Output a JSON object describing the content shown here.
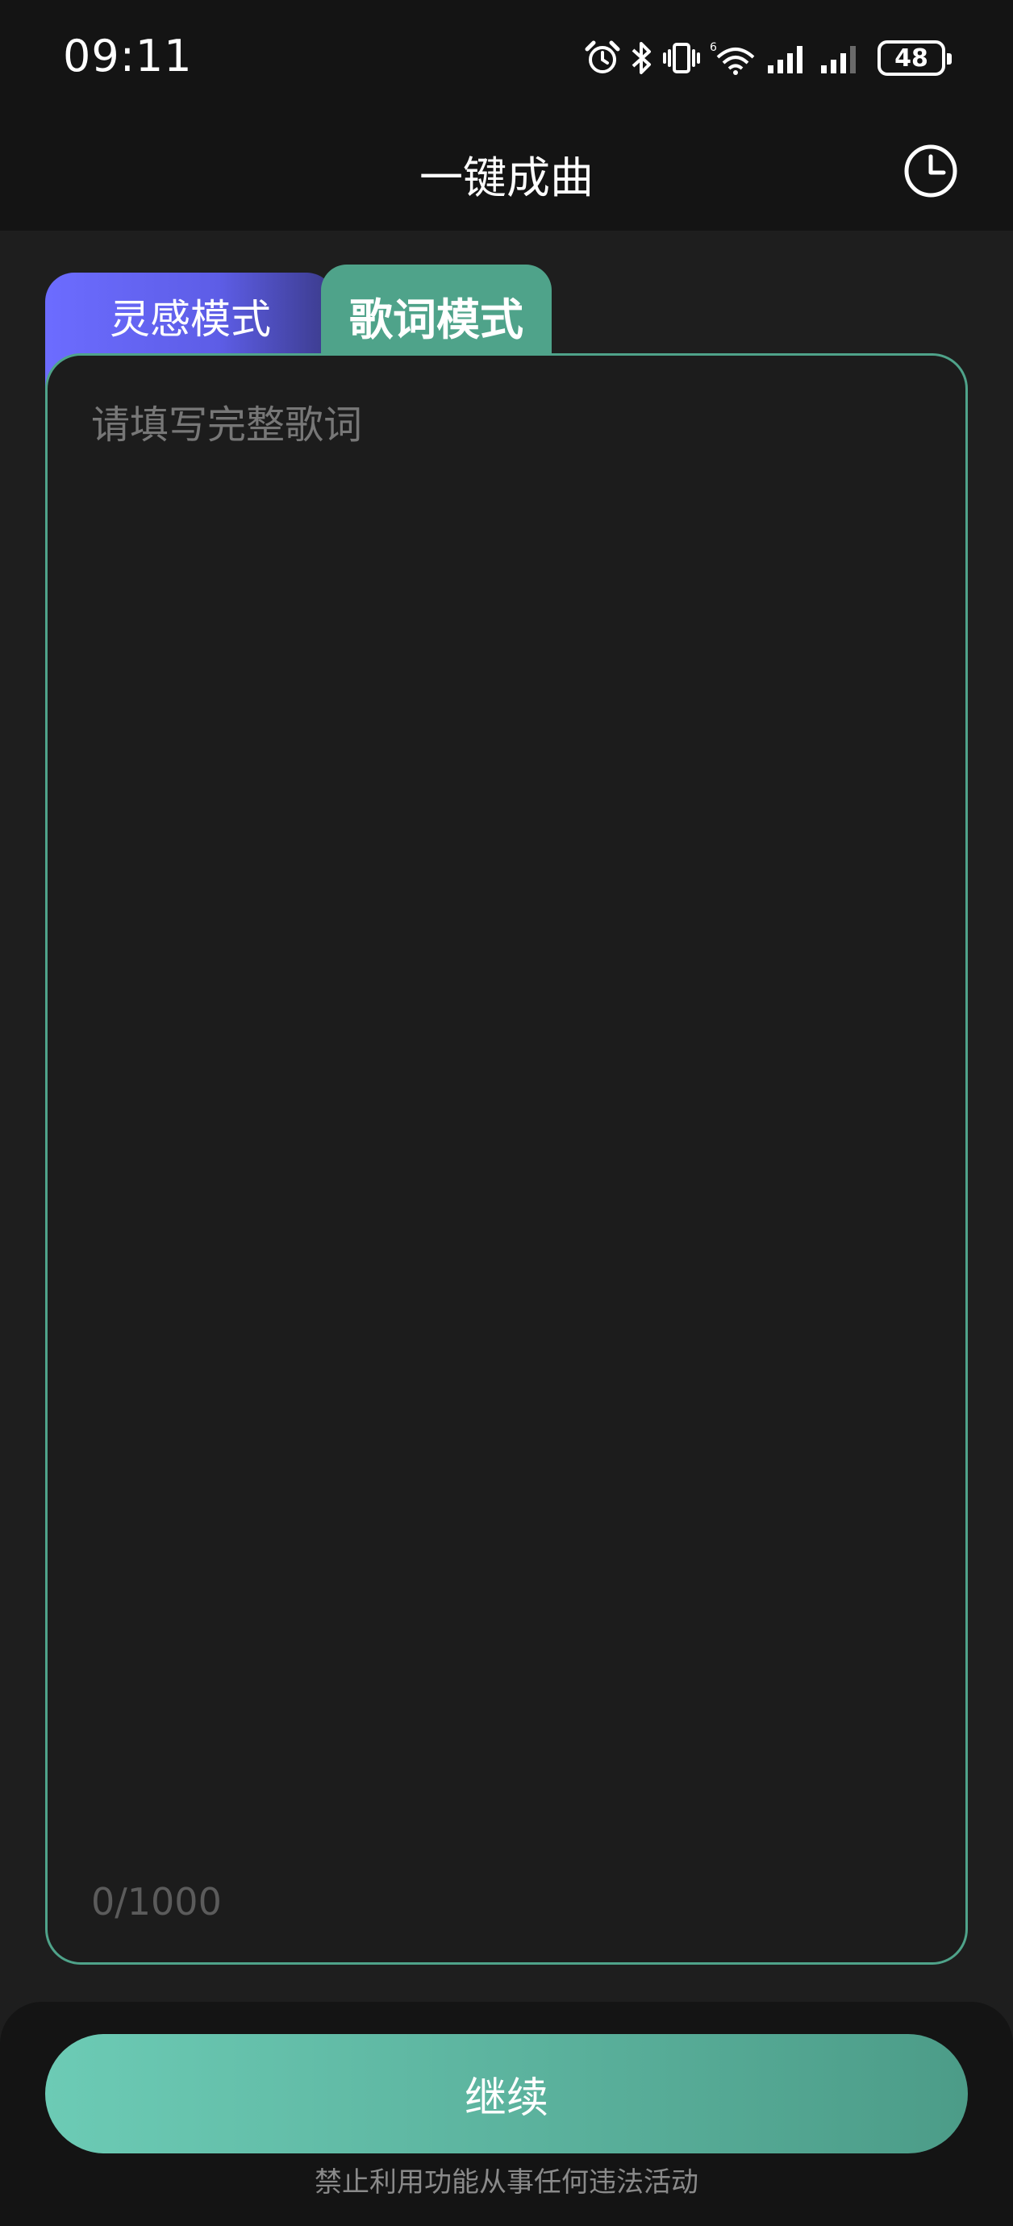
{
  "status_bar": {
    "time": "09:11",
    "battery_level": "48",
    "icons": [
      "alarm-icon",
      "bluetooth-icon",
      "vibrate-icon",
      "wifi-icon",
      "signal-icon",
      "signal-icon"
    ]
  },
  "header": {
    "title": "一键成曲",
    "history_icon": "clock-icon"
  },
  "tabs": [
    {
      "label": "灵感模式",
      "active": false
    },
    {
      "label": "歌词模式",
      "active": true
    }
  ],
  "editor": {
    "placeholder": "请填写完整歌词",
    "value": "",
    "char_count": "0/1000"
  },
  "footer": {
    "continue_label": "继续",
    "disclaimer": "禁止利用功能从事任何违法活动"
  },
  "colors": {
    "accent_green": "#4fa38a",
    "accent_purple": "#6c6cff",
    "background": "#1e1e1e",
    "bar_background": "#141414"
  }
}
